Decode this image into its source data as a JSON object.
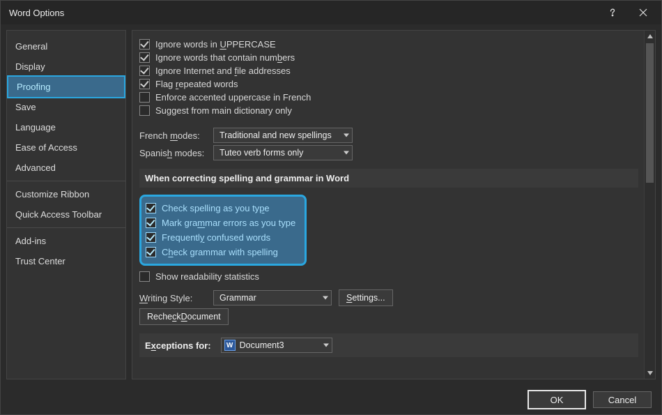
{
  "titlebar": {
    "title": "Word Options"
  },
  "sidebar": {
    "items": [
      "General",
      "Display",
      "Proofing",
      "Save",
      "Language",
      "Ease of Access",
      "Advanced",
      "Customize Ribbon",
      "Quick Access Toolbar",
      "Add-ins",
      "Trust Center"
    ],
    "selected_index": 2,
    "separators_after": [
      6,
      8
    ]
  },
  "autocorrect": {
    "ignore_uppercase_pre": "Ignore words in ",
    "ignore_uppercase_u": "U",
    "ignore_uppercase_post": "PPERCASE",
    "ignore_numbers": "Ignore words that contain numbers",
    "ignore_numbers_und": "b",
    "ignore_internet_pre": "Ignore Internet and ",
    "ignore_internet_u": "f",
    "ignore_internet_post": "ile addresses",
    "flag_repeated_pre": "Flag ",
    "flag_repeated_u": "r",
    "flag_repeated_post": "epeated words",
    "enforce_french": "Enforce accented uppercase in French",
    "suggest_main": "Suggest from main dictionary only"
  },
  "modes": {
    "french_label_pre": "French ",
    "french_label_u": "m",
    "french_label_post": "odes:",
    "french_value": "Traditional and new spellings",
    "spanish_label_pre": "Spanis",
    "spanish_label_u": "h",
    "spanish_label_post": " modes:",
    "spanish_value": "Tuteo verb forms only"
  },
  "section1_title": "When correcting spelling and grammar in Word",
  "word_correct": {
    "check_spelling_pre": "Check spelling as you ty",
    "check_spelling_u": "p",
    "check_spelling_post": "e",
    "mark_grammar_pre": "Mark gra",
    "mark_grammar_u": "m",
    "mark_grammar_post": "mar errors as you type",
    "freq_confused_pre": "Frequentl",
    "freq_confused_u": "y",
    "freq_confused_post": " confused words",
    "grammar_with_spell_pre": "C",
    "grammar_with_spell_u": "h",
    "grammar_with_spell_post": "eck grammar with spelling",
    "readability": "Show readability statistics"
  },
  "writing_style": {
    "label_pre": "",
    "label_u": "W",
    "label_post": "riting Style:",
    "value": "Grammar",
    "settings_u": "S",
    "settings_post": "ettings..."
  },
  "recheck_pre": "Reche",
  "recheck_u": "c",
  "recheck_post": "k ",
  "recheck_u2": "D",
  "recheck_post2": "ocument",
  "exceptions": {
    "label_pre": "E",
    "label_u": "x",
    "label_post": "ceptions for:",
    "value": "Document3"
  },
  "buttons": {
    "ok": "OK",
    "cancel": "Cancel"
  }
}
